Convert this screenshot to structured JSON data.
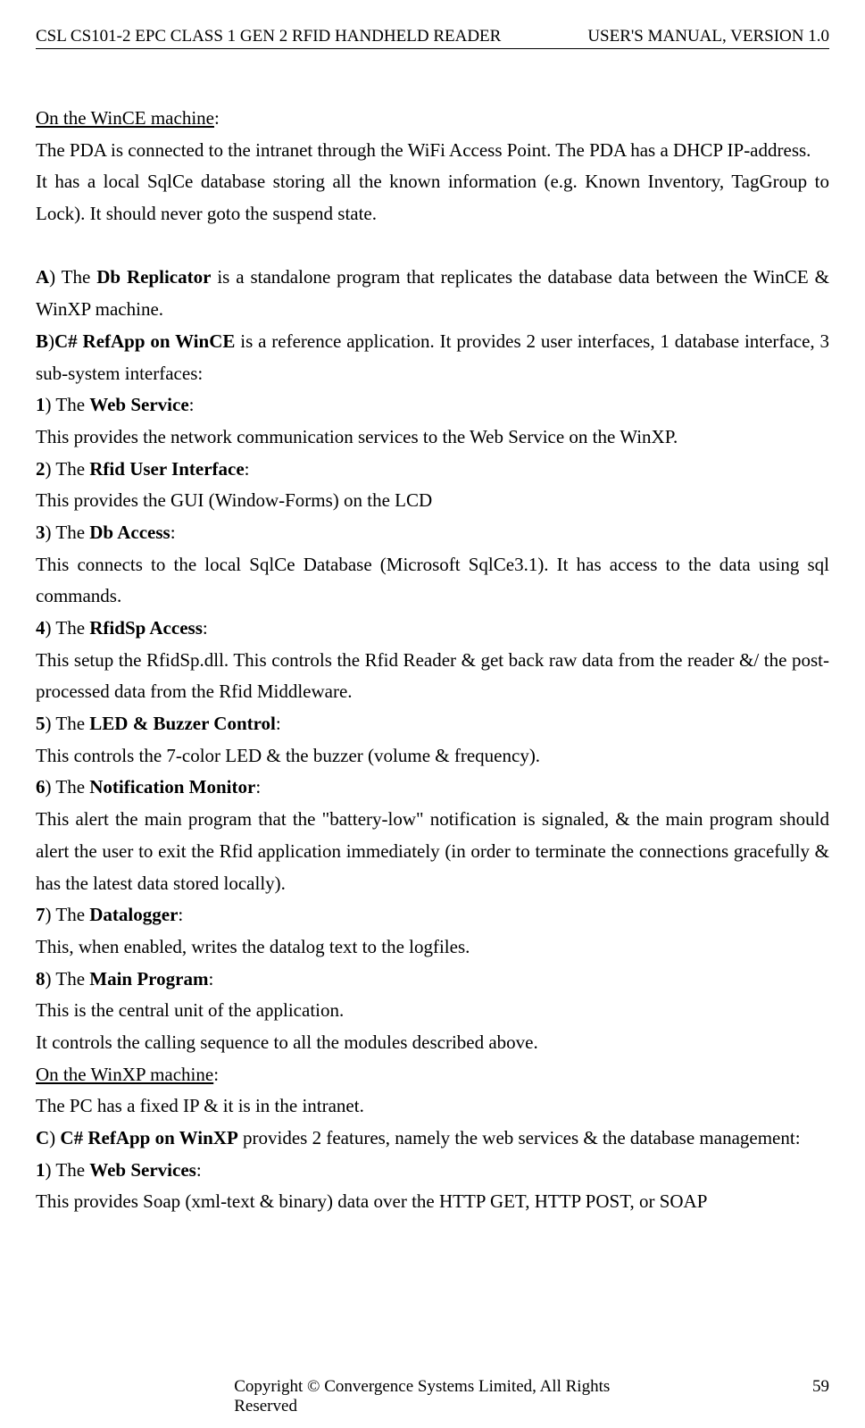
{
  "header": {
    "left": "CSL CS101-2 EPC CLASS 1 GEN 2 RFID HANDHELD READER",
    "right": "USER'S  MANUAL,  VERSION  1.0"
  },
  "content": {
    "section1_title": "On the WinCE machine",
    "section1_p1": "The PDA is connected to the intranet through the WiFi Access Point. The PDA has a DHCP IP-address.",
    "section1_p2": "It has a local SqlCe database storing all the known information (e.g. Known Inventory, TagGroup to Lock). It should never goto the suspend state.",
    "a_label": "A",
    "a_bold": "Db Replicator",
    "a_text": " is a standalone program that replicates the database data between the WinCE & WinXP machine.",
    "b_label": "B",
    "b_bold": "C# RefApp on WinCE",
    "b_text": " is a reference application.    It provides 2 user interfaces, 1 database interface, 3 sub-system interfaces:",
    "item1_label": "1",
    "item1_bold": "Web Service",
    "item1_text": "This provides the network communication services to the Web Service on the WinXP.",
    "item2_label": "2",
    "item2_bold": "Rfid User Interface",
    "item2_text": "This provides the GUI (Window-Forms) on the LCD",
    "item3_label": "3",
    "item3_bold": "Db Access",
    "item3_text": "This connects to the local SqlCe Database (Microsoft SqlCe3.1). It has access to the data using sql commands.",
    "item4_label": "4",
    "item4_bold": "RfidSp Access",
    "item4_text": "This setup the RfidSp.dll. This controls the Rfid Reader & get back raw data from the reader &/ the post-processed data from the Rfid Middleware.",
    "item5_label": "5",
    "item5_bold": "LED & Buzzer Control",
    "item5_text": "This controls the 7-color LED & the buzzer (volume & frequency).",
    "item6_label": "6",
    "item6_bold": "Notification Monitor",
    "item6_text": "This alert the main program that the \"battery-low\" notification is signaled, & the main program should alert the user to exit the Rfid application immediately (in order to terminate the connections gracefully & has the latest data stored locally).",
    "item7_label": "7",
    "item7_bold": "Datalogger",
    "item7_text": "This, when enabled, writes the datalog text to the logfiles.",
    "item8_label": "8",
    "item8_bold": "Main Program",
    "item8_text1": "This is the central unit of the application.",
    "item8_text2": "It controls the calling sequence to all the modules described above.",
    "section2_title": "On the WinXP machine",
    "section2_p1": "The PC has a fixed IP & it is in the intranet.",
    "c_label": "C",
    "c_bold": "C# RefApp on WinXP",
    "c_text": " provides 2 features, namely the web services & the database management:",
    "xitem1_label": "1",
    "xitem1_bold": "Web Services",
    "xitem1_text": "This provides Soap (xml-text & binary) data over the HTTP GET, HTTP POST, or SOAP"
  },
  "footer": {
    "center": "Copyright © Convergence Systems Limited, All Rights Reserved",
    "page": "59"
  }
}
